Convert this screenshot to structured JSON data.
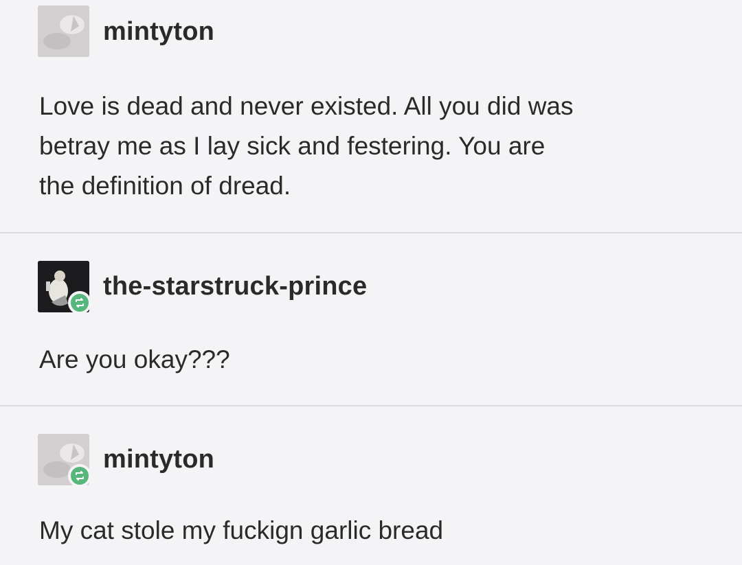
{
  "posts": [
    {
      "username": "mintyton",
      "lines": [
        "Love is dead and never existed. All you did was",
        "betray me as I lay sick and festering. You are",
        "the definition of dread."
      ],
      "reblog": false
    },
    {
      "username": "the-starstruck-prince",
      "lines": [
        "Are you okay???"
      ],
      "reblog": true
    },
    {
      "username": "mintyton",
      "lines": [
        "My cat stole my fuckign garlic bread"
      ],
      "reblog": true
    }
  ],
  "colors": {
    "background": "#f4f3f5",
    "text": "#2a2a2a",
    "reblog_badge": "#56b67c",
    "divider": "#dcdadc"
  }
}
